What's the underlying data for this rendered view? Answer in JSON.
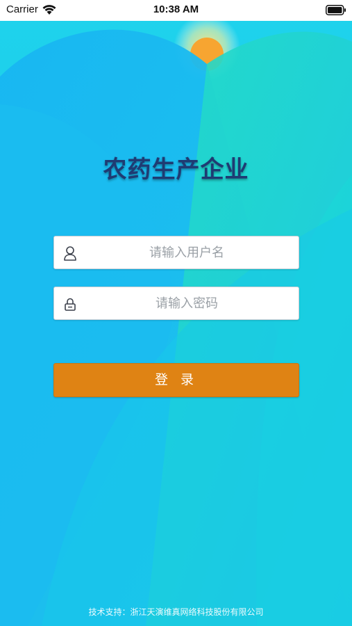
{
  "status_bar": {
    "carrier": "Carrier",
    "time": "10:38 AM"
  },
  "app": {
    "title": "农药生产企业"
  },
  "login_form": {
    "username_placeholder": "请输入用户名",
    "password_placeholder": "请输入密码",
    "login_label": "登 录"
  },
  "footer": {
    "text": "技术支持：浙江天演维真网络科技股份有限公司"
  },
  "icons": {
    "username": "user-icon",
    "password": "lock-icon",
    "wifi": "wifi-icon",
    "battery": "battery-icon"
  },
  "colors": {
    "button": "#df8314",
    "title": "#1f3b73",
    "background_top": "#2fd6ee",
    "background_bottom": "#12b8f0"
  }
}
